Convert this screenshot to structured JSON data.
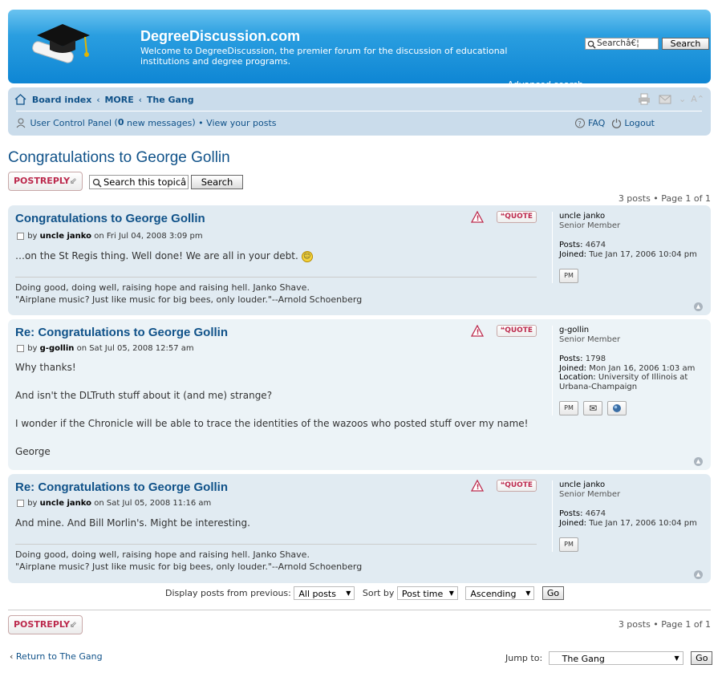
{
  "header": {
    "site_title": "DegreeDiscussion.com",
    "site_desc": "Welcome to DegreeDiscussion, the premier forum for the discussion of educational institutions and degree programs.",
    "search_value": "Searchâ€¦",
    "search_button": "Search",
    "advanced_search": "Advanced search"
  },
  "nav": {
    "breadcrumbs": [
      "Board index",
      "MORE",
      "The Gang"
    ],
    "crumb_sep": "‹",
    "ucp": "User Control Panel",
    "new_messages_count": "0",
    "new_messages_text": "new messages",
    "view_posts": "View your posts",
    "faq": "FAQ",
    "logout": "Logout",
    "font_size": "A"
  },
  "topic": {
    "title": "Congratulations to George Gollin",
    "post_reply": "POSTREPLY",
    "search_value": "Search this topicâ",
    "search_button": "Search",
    "pagination": "3 posts • Page 1 of 1"
  },
  "posts": [
    {
      "title": "Congratulations to George Gollin",
      "by": "by",
      "author": "uncle janko",
      "on": "on Fri Jul 04, 2008 3:09 pm",
      "content": [
        "…on the St Regis thing. Well done! We are all in your debt."
      ],
      "signature": [
        "Doing good, doing well, raising hope and raising hell. Janko Shave.",
        "\"Airplane music? Just like music for big bees, only louder.\"--Arnold Schoenberg"
      ],
      "quote": "QUOTE",
      "profile": {
        "username": "uncle janko",
        "rank": "Senior Member",
        "posts_label": "Posts:",
        "posts": "4674",
        "joined_label": "Joined:",
        "joined": "Tue Jan 17, 2006 10:04 pm"
      }
    },
    {
      "title": "Re: Congratulations to George Gollin",
      "by": "by",
      "author": "g-gollin",
      "on": "on Sat Jul 05, 2008 12:57 am",
      "content": [
        "Why thanks!",
        "And isn't the DLTruth stuff about it (and me) strange?",
        "I wonder if the Chronicle will be able to trace the identities of the wazoos who posted stuff over my name!",
        "George"
      ],
      "quote": "QUOTE",
      "profile": {
        "username": "g-gollin",
        "rank": "Senior Member",
        "posts_label": "Posts:",
        "posts": "1798",
        "joined_label": "Joined:",
        "joined": "Mon Jan 16, 2006 1:03 am",
        "location_label": "Location:",
        "location": "University of Illinois at Urbana-Champaign"
      }
    },
    {
      "title": "Re: Congratulations to George Gollin",
      "by": "by",
      "author": "uncle janko",
      "on": "on Sat Jul 05, 2008 11:16 am",
      "content": [
        "And mine. And Bill Morlin's. Might be interesting."
      ],
      "signature": [
        "Doing good, doing well, raising hope and raising hell. Janko Shave.",
        "\"Airplane music? Just like music for big bees, only louder.\"--Arnold Schoenberg"
      ],
      "quote": "QUOTE",
      "profile": {
        "username": "uncle janko",
        "rank": "Senior Member",
        "posts_label": "Posts:",
        "posts": "4674",
        "joined_label": "Joined:",
        "joined": "Tue Jan 17, 2006 10:04 pm"
      }
    }
  ],
  "display": {
    "label": "Display posts from previous:",
    "previous_value": "All posts",
    "sort_label": "Sort by",
    "sort_value": "Post time",
    "order_value": "Ascending",
    "go": "Go"
  },
  "footer": {
    "return_link": "Return to The Gang",
    "return_arrow": "‹",
    "jump_label": "Jump to:",
    "jump_value": "The Gang",
    "go": "Go"
  },
  "icons": {
    "pm_label": "PM",
    "email_glyph": "✉",
    "top_glyph": "▲"
  },
  "colors": {
    "header_blue": "#0e86d4",
    "nav_bg": "#cadceb",
    "link": "#105289",
    "post_reply_red": "#bc2a4d"
  }
}
